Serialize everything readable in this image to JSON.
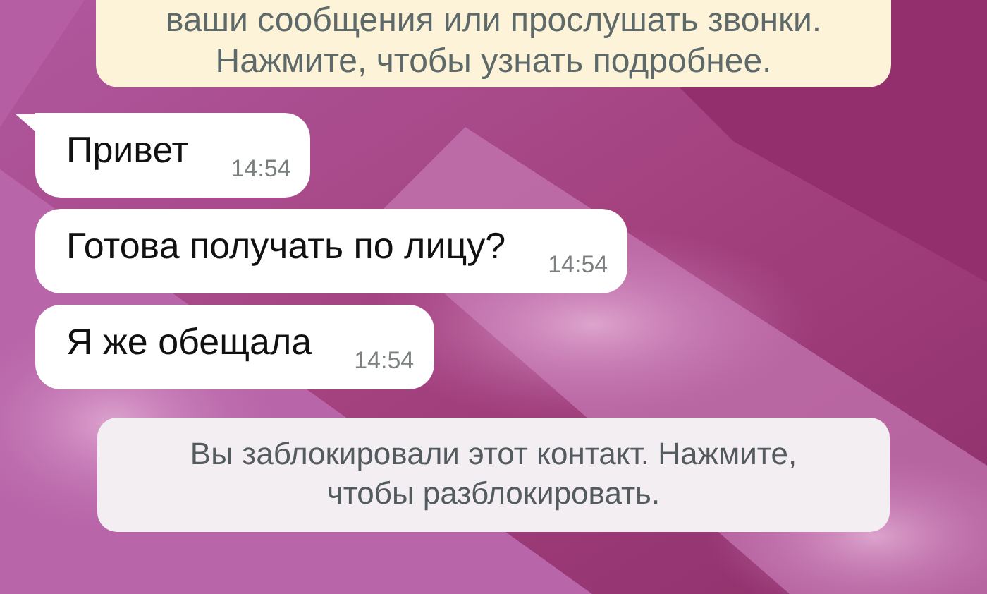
{
  "encryption_notice": {
    "lines": [
      "ваши сообщения или прослушать звонки.",
      "Нажмите, чтобы узнать подробнее."
    ]
  },
  "messages": [
    {
      "text": "Привет",
      "time": "14:54",
      "tail": true
    },
    {
      "text": "Готова получать по лицу?",
      "time": "14:54",
      "tail": false
    },
    {
      "text": "Я же обещала",
      "time": "14:54",
      "tail": false
    }
  ],
  "blocked_notice": {
    "lines": [
      "Вы заблокировали этот контакт. Нажмите,",
      "чтобы разблокировать."
    ]
  }
}
